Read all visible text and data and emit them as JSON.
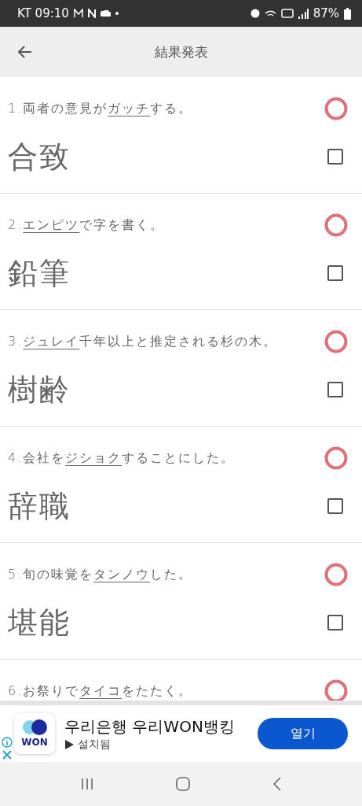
{
  "status_bar": {
    "carrier_time": "KT 09:10",
    "battery": "87%"
  },
  "app_bar": {
    "title": "結果発表"
  },
  "items": [
    {
      "before": "1.両者の意見が",
      "underlined": "ガッチ",
      "after": "する。",
      "answer": "合致",
      "correct": true,
      "checked": false
    },
    {
      "before": "2.",
      "underlined": "エンピツ",
      "after": "で字を書く。",
      "answer": "鉛筆",
      "correct": true,
      "checked": false
    },
    {
      "before": "3.",
      "underlined": "ジュレイ",
      "after": "千年以上と推定される杉の木。",
      "answer": "樹齢",
      "correct": true,
      "checked": false
    },
    {
      "before": "4.会社を",
      "underlined": "ジショク",
      "after": "することにした。",
      "answer": "辞職",
      "correct": true,
      "checked": false
    },
    {
      "before": "5.旬の味覚を",
      "underlined": "タンノウ",
      "after": "した。",
      "answer": "堪能",
      "correct": true,
      "checked": false
    },
    {
      "before": "6.お祭りで",
      "underlined": "タイコ",
      "after": "をたたく。",
      "correct": true
    }
  ],
  "ad": {
    "logo": "WON",
    "title": "우리은행 우리WON뱅킹",
    "status": "설치됨",
    "button": "열기"
  }
}
